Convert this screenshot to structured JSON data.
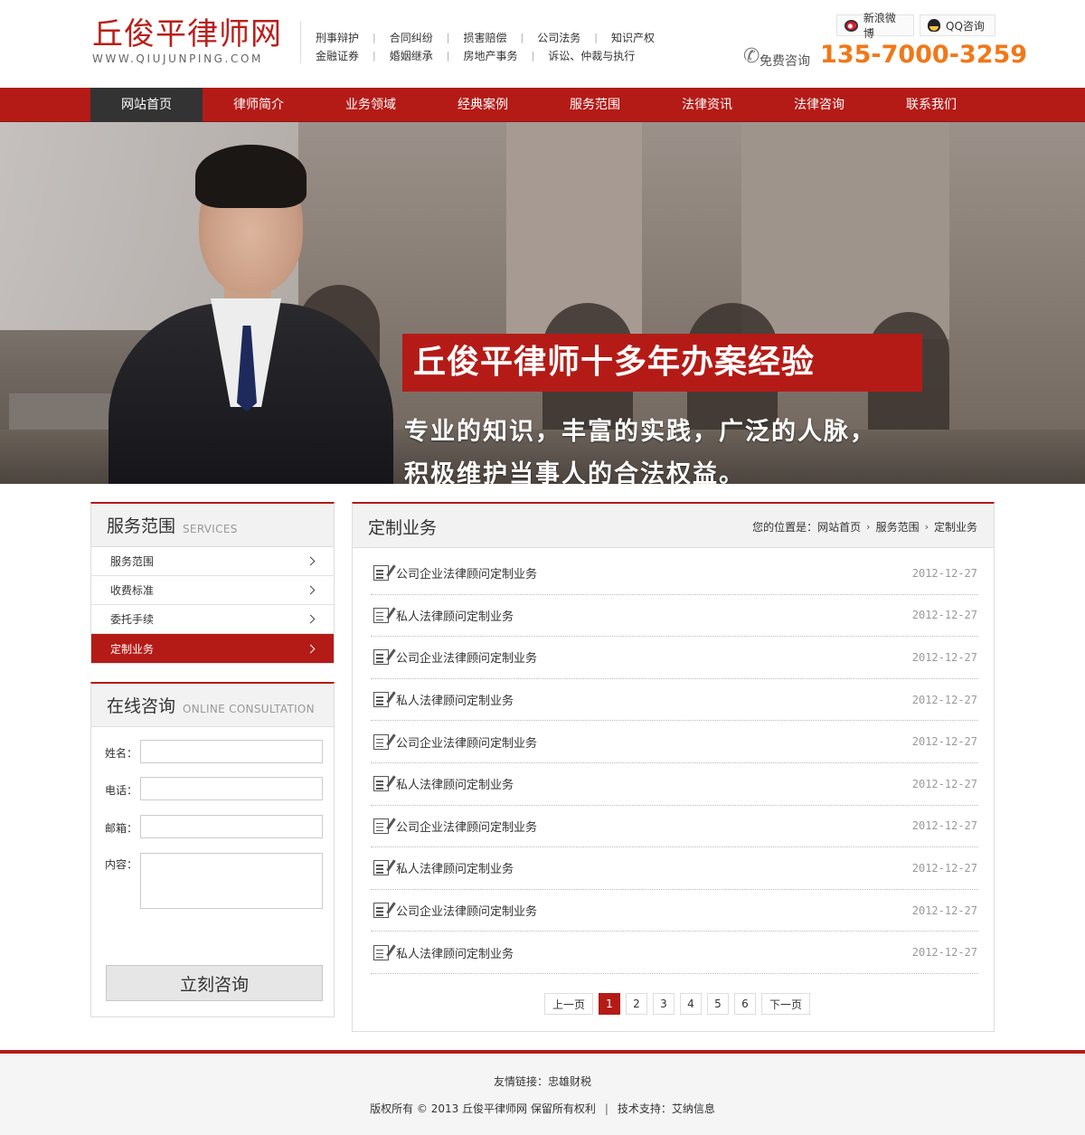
{
  "header": {
    "logo_cn": "丘俊平律师网",
    "logo_en": "WWW.QIUJUNPING.COM",
    "quick_links_row1": [
      "刑事辩护",
      "合同纠纷",
      "损害赔偿",
      "公司法务",
      "知识产权"
    ],
    "quick_links_row2": [
      "金融证券",
      "婚姻继承",
      "房地产事务",
      "诉讼、仲裁与执行"
    ],
    "weibo_label": "新浪微博",
    "qq_label": "QQ咨询",
    "hotline_label": "免费咨询",
    "hotline_number": "135-7000-3259",
    "phone_icon": "phone-icon"
  },
  "nav": {
    "items": [
      "网站首页",
      "律师简介",
      "业务领域",
      "经典案例",
      "服务范围",
      "法律资讯",
      "法律咨询",
      "联系我们"
    ],
    "active_index": 0
  },
  "banner": {
    "title": "丘俊平律师十多年办案经验",
    "line1": "专业的知识，丰富的实践，广泛的人脉，",
    "line2": "积极维护当事人的合法权益。"
  },
  "services": {
    "title_cn": "服务范围",
    "title_en": "SERVICES",
    "items": [
      "服务范围",
      "收费标准",
      "委托手续",
      "定制业务"
    ],
    "active_index": 3
  },
  "consult": {
    "title_cn": "在线咨询",
    "title_en": "ONLINE CONSULTATION",
    "name_label": "姓名：",
    "phone_label": "电话：",
    "email_label": "邮箱：",
    "content_label": "内容：",
    "submit_label": "立刻咨询"
  },
  "main": {
    "title": "定制业务",
    "breadcrumb_prefix": "您的位置是：",
    "breadcrumb": [
      "网站首页",
      "服务范围",
      "定制业务"
    ],
    "articles": [
      {
        "title": "公司企业法律顾问定制业务",
        "date": "2012-12-27"
      },
      {
        "title": "私人法律顾问定制业务",
        "date": "2012-12-27"
      },
      {
        "title": "公司企业法律顾问定制业务",
        "date": "2012-12-27"
      },
      {
        "title": "私人法律顾问定制业务",
        "date": "2012-12-27"
      },
      {
        "title": "公司企业法律顾问定制业务",
        "date": "2012-12-27"
      },
      {
        "title": "私人法律顾问定制业务",
        "date": "2012-12-27"
      },
      {
        "title": "公司企业法律顾问定制业务",
        "date": "2012-12-27"
      },
      {
        "title": "私人法律顾问定制业务",
        "date": "2012-12-27"
      },
      {
        "title": "公司企业法律顾问定制业务",
        "date": "2012-12-27"
      },
      {
        "title": "私人法律顾问定制业务",
        "date": "2012-12-27"
      }
    ],
    "pager": {
      "prev": "上一页",
      "pages": [
        "1",
        "2",
        "3",
        "4",
        "5",
        "6"
      ],
      "current": "1",
      "next": "下一页"
    }
  },
  "footer": {
    "links_prefix": "友情链接：",
    "link": "忠雄财税",
    "copyright": "版权所有 © 2013 丘俊平律师网 保留所有权利",
    "support": "技术支持：艾纳信息"
  },
  "colors": {
    "brand_red": "#b41b17",
    "hotline_orange": "#f07819",
    "nav_active": "#333333"
  }
}
